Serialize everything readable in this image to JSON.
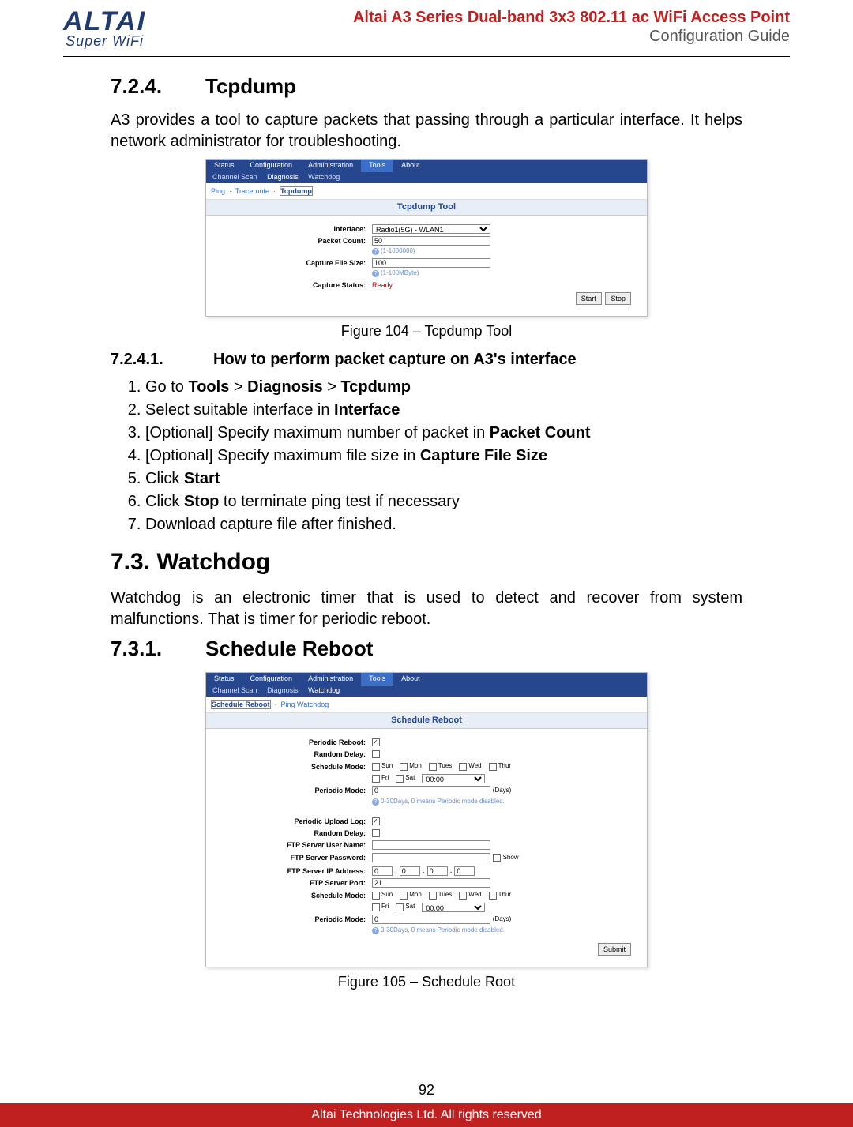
{
  "header": {
    "logo_main": "ALTAI",
    "logo_sub": "Super WiFi",
    "title_red": "Altai A3 Series Dual-band 3x3 802.11 ac WiFi Access Point",
    "title_gray": "Configuration Guide"
  },
  "sections": {
    "s724_num": "7.2.4.",
    "s724_title": "Tcpdump",
    "s724_para": "A3 provides a tool to capture packets that passing through a particular interface. It helps network administrator for troubleshooting.",
    "fig104": "Figure 104 – Tcpdump Tool",
    "s7241_num": "7.2.4.1.",
    "s7241_title": "How to perform packet capture on A3's interface",
    "steps": [
      {
        "pre": "Go to ",
        "bold": "Tools",
        "mid": " > ",
        "bold2": "Diagnosis",
        "mid2": " > ",
        "bold3": "Tcpdump"
      },
      {
        "pre": "Select suitable interface in ",
        "bold": "Interface"
      },
      {
        "pre": "[Optional] Specify maximum number of packet in ",
        "bold": "Packet Count"
      },
      {
        "pre": "[Optional] Specify maximum file size in ",
        "bold": "Capture File Size"
      },
      {
        "pre": "Click ",
        "bold": "Start"
      },
      {
        "pre": "Click ",
        "bold": "Stop",
        "post": " to terminate ping test if necessary"
      },
      {
        "pre": "Download capture file after finished."
      }
    ],
    "s73_title": "7.3. Watchdog",
    "s73_para": "Watchdog is an electronic timer that is used to detect and recover from system malfunctions. That is timer for periodic reboot.",
    "s731_num": "7.3.1.",
    "s731_title": "Schedule Reboot",
    "fig105": "Figure 105 – Schedule Root"
  },
  "shot1": {
    "tabs": [
      "Status",
      "Configuration",
      "Administration",
      "Tools",
      "About"
    ],
    "active_tab": "Tools",
    "sub": [
      "Channel Scan",
      "Diagnosis",
      "Watchdog"
    ],
    "sub_on": "Diagnosis",
    "subtabs": [
      "Ping",
      "Traceroute",
      "Tcpdump"
    ],
    "subtab_sel": "Tcpdump",
    "panel": "Tcpdump Tool",
    "labels": {
      "interface": "Interface:",
      "packet_count": "Packet Count:",
      "capture_file_size": "Capture File Size:",
      "capture_status": "Capture Status:"
    },
    "interface_value": "Radio1(5G) - WLAN1",
    "packet_count_value": "50",
    "packet_count_hint": "(1-1000000)",
    "file_size_value": "100",
    "file_size_hint": "(1-100MByte)",
    "status": "Ready",
    "btn_start": "Start",
    "btn_stop": "Stop"
  },
  "shot2": {
    "tabs": [
      "Status",
      "Configuration",
      "Administration",
      "Tools",
      "About"
    ],
    "active_tab": "Tools",
    "sub": [
      "Channel Scan",
      "Diagnosis",
      "Watchdog"
    ],
    "sub_on": "Watchdog",
    "subtabs": [
      "Schedule Reboot",
      "Ping Watchdog"
    ],
    "subtab_sel": "Schedule Reboot",
    "panel": "Schedule Reboot",
    "labels": {
      "periodic_reboot": "Periodic Reboot:",
      "random_delay": "Random Delay:",
      "schedule_mode": "Schedule Mode:",
      "periodic_mode": "Periodic Mode:",
      "periodic_upload": "Periodic Upload Log:",
      "ftp_user": "FTP Server User Name:",
      "ftp_pass": "FTP Server Password:",
      "ftp_ip": "FTP Server IP Address:",
      "ftp_port": "FTP Server Port:"
    },
    "days": [
      "Sun",
      "Mon",
      "Tues",
      "Wed",
      "Thur",
      "Fri",
      "Sat"
    ],
    "time_value": "00:00",
    "periodic_value": "0",
    "periodic_unit": "(Days)",
    "periodic_hint": "0-30Days, 0 means Periodic mode disabled.",
    "ip_octets": [
      "0",
      "0",
      "0",
      "0"
    ],
    "port_value": "21",
    "show_label": "Show",
    "submit_label": "Submit"
  },
  "footer": {
    "page": "92",
    "copyright": "Altai Technologies Ltd. All rights reserved"
  }
}
